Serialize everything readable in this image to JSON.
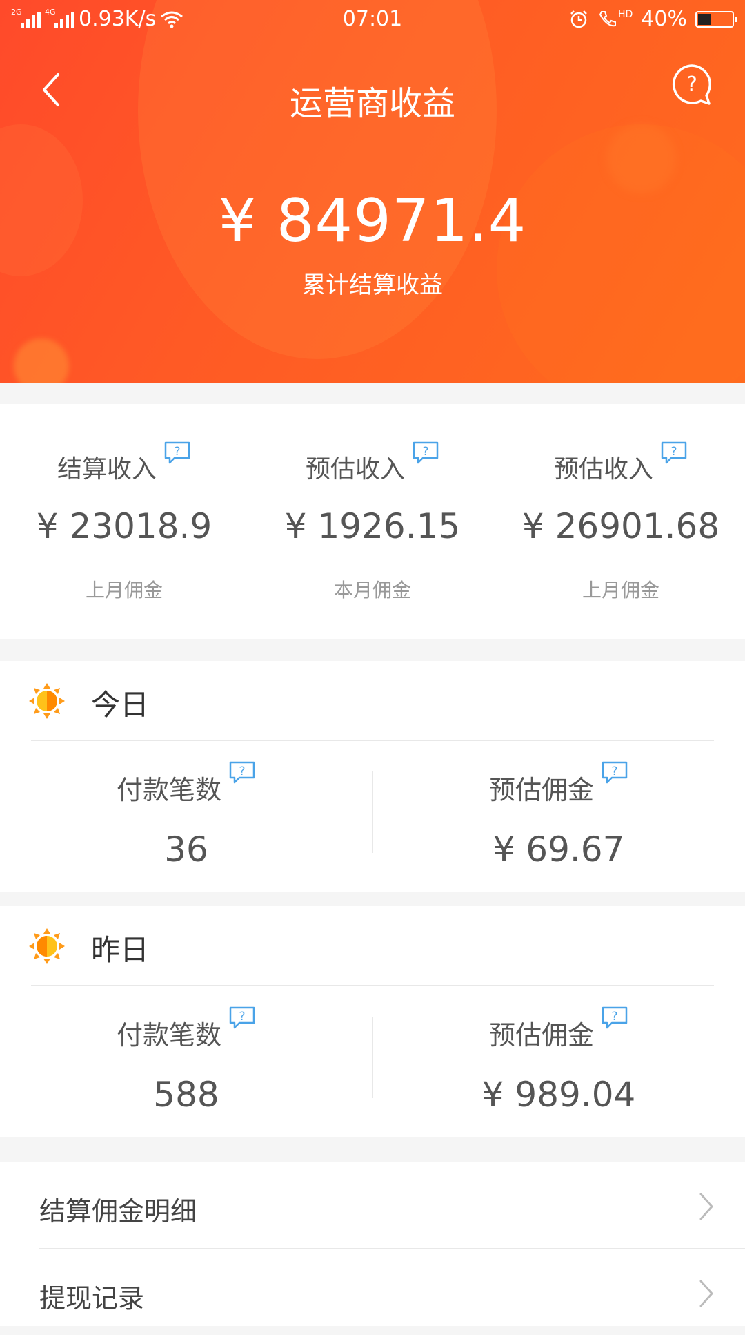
{
  "status_bar": {
    "network_1": "2G",
    "network_2": "4G",
    "speed": "0.93K/s",
    "time": "07:01",
    "hd": "HD",
    "battery": "40%",
    "battery_level": 0.4
  },
  "header": {
    "title": "运营商收益",
    "total_amount": "¥ 84971.4",
    "total_label": "累计结算收益"
  },
  "summary": [
    {
      "label": "结算收入",
      "value": "¥ 23018.9",
      "sub": "上月佣金"
    },
    {
      "label": "预估收入",
      "value": "¥ 1926.15",
      "sub": "本月佣金"
    },
    {
      "label": "预估收入",
      "value": "¥ 26901.68",
      "sub": "上月佣金"
    }
  ],
  "today": {
    "title": "今日",
    "orders_label": "付款笔数",
    "orders_value": "36",
    "commission_label": "预估佣金",
    "commission_value": "¥ 69.67"
  },
  "yesterday": {
    "title": "昨日",
    "orders_label": "付款笔数",
    "orders_value": "588",
    "commission_label": "预估佣金",
    "commission_value": "¥ 989.04"
  },
  "links": [
    {
      "label": "结算佣金明细"
    },
    {
      "label": "提现记录"
    }
  ],
  "colors": {
    "accent": "#ff5a25",
    "help_blue": "#4aa3e8",
    "sun_orange": "#ff9b1a"
  },
  "icons": {
    "back": "chevron-left-icon",
    "help": "question-bubble-icon",
    "info": "question-bubble-icon",
    "sun": "sun-icon",
    "chevron": "chevron-right-icon"
  }
}
